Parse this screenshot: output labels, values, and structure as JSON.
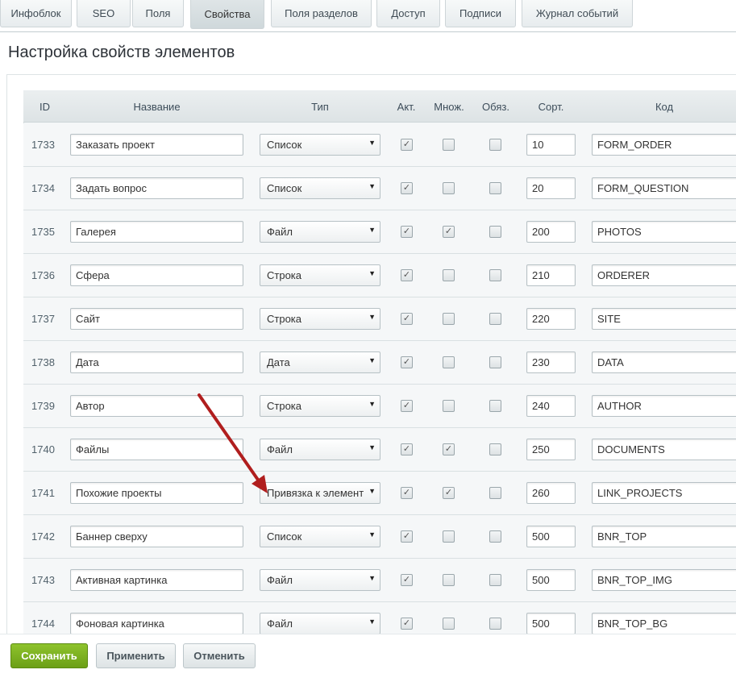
{
  "tabs": [
    {
      "label": "Инфоблок"
    },
    {
      "label": "SEO"
    },
    {
      "label": "Поля"
    },
    {
      "label": "Свойства"
    },
    {
      "label": "Поля разделов"
    },
    {
      "label": "Доступ"
    },
    {
      "label": "Подписи"
    },
    {
      "label": "Журнал событий"
    }
  ],
  "active_tab": "Свойства",
  "page_title": "Настройка свойств элементов",
  "table": {
    "headers": {
      "id": "ID",
      "name": "Название",
      "type": "Тип",
      "active": "Акт.",
      "multiple": "Множ.",
      "required": "Обяз.",
      "sort": "Сорт.",
      "code": "Код"
    },
    "rows": [
      {
        "id": "1733",
        "name": "Заказать проект",
        "type": "Список",
        "active": true,
        "multiple": false,
        "required": false,
        "sort": "10",
        "code": "FORM_ORDER"
      },
      {
        "id": "1734",
        "name": "Задать вопрос",
        "type": "Список",
        "active": true,
        "multiple": false,
        "required": false,
        "sort": "20",
        "code": "FORM_QUESTION"
      },
      {
        "id": "1735",
        "name": "Галерея",
        "type": "Файл",
        "active": true,
        "multiple": true,
        "required": false,
        "sort": "200",
        "code": "PHOTOS"
      },
      {
        "id": "1736",
        "name": "Сфера",
        "type": "Строка",
        "active": true,
        "multiple": false,
        "required": false,
        "sort": "210",
        "code": "ORDERER"
      },
      {
        "id": "1737",
        "name": "Сайт",
        "type": "Строка",
        "active": true,
        "multiple": false,
        "required": false,
        "sort": "220",
        "code": "SITE"
      },
      {
        "id": "1738",
        "name": "Дата",
        "type": "Дата",
        "active": true,
        "multiple": false,
        "required": false,
        "sort": "230",
        "code": "DATA"
      },
      {
        "id": "1739",
        "name": "Автор",
        "type": "Строка",
        "active": true,
        "multiple": false,
        "required": false,
        "sort": "240",
        "code": "AUTHOR"
      },
      {
        "id": "1740",
        "name": "Файлы",
        "type": "Файл",
        "active": true,
        "multiple": true,
        "required": false,
        "sort": "250",
        "code": "DOCUMENTS"
      },
      {
        "id": "1741",
        "name": "Похожие проекты",
        "type": "Привязка к элемент",
        "active": true,
        "multiple": true,
        "required": false,
        "sort": "260",
        "code": "LINK_PROJECTS"
      },
      {
        "id": "1742",
        "name": "Баннер сверху",
        "type": "Список",
        "active": true,
        "multiple": false,
        "required": false,
        "sort": "500",
        "code": "BNR_TOP"
      },
      {
        "id": "1743",
        "name": "Активная картинка",
        "type": "Файл",
        "active": true,
        "multiple": false,
        "required": false,
        "sort": "500",
        "code": "BNR_TOP_IMG"
      },
      {
        "id": "1744",
        "name": "Фоновая картинка",
        "type": "Файл",
        "active": true,
        "multiple": false,
        "required": false,
        "sort": "500",
        "code": "BNR_TOP_BG"
      }
    ]
  },
  "buttons": {
    "save": "Сохранить",
    "apply": "Применить",
    "cancel": "Отменить"
  },
  "colors": {
    "save_button": "#7cb41f",
    "annotation_arrow": "#b01e1e"
  },
  "icons": {
    "select_arrow": "▼",
    "checkmark": "✓"
  }
}
